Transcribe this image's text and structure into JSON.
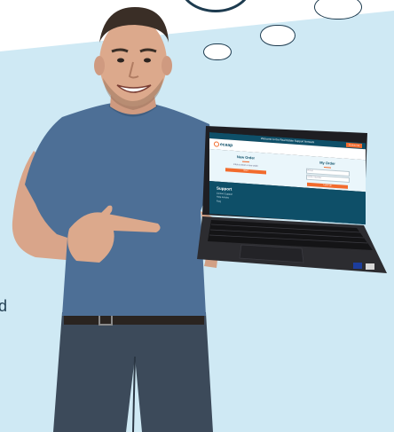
{
  "decor": {
    "colors": {
      "band": "#cfe9f4",
      "navy": "#1d3b4f",
      "accent": "#f26b2d",
      "screen_dark": "#0e4f68"
    }
  },
  "left_fragment": "d",
  "laptop_screen": {
    "top_banner": "Welcome to the Real Estate Support Network",
    "top_button": "Contact Us",
    "logo_text": "ecaap",
    "new_order": {
      "title": "New Order",
      "note": "Click to start a new order",
      "button": "Start"
    },
    "my_order": {
      "title": "My Order",
      "field1_placeholder": "Email",
      "field2_placeholder": "Order Number",
      "button": "Look Up"
    },
    "support": {
      "title": "Support",
      "links": [
        "Contact Support",
        "Help Articles",
        "FAQ"
      ]
    }
  }
}
